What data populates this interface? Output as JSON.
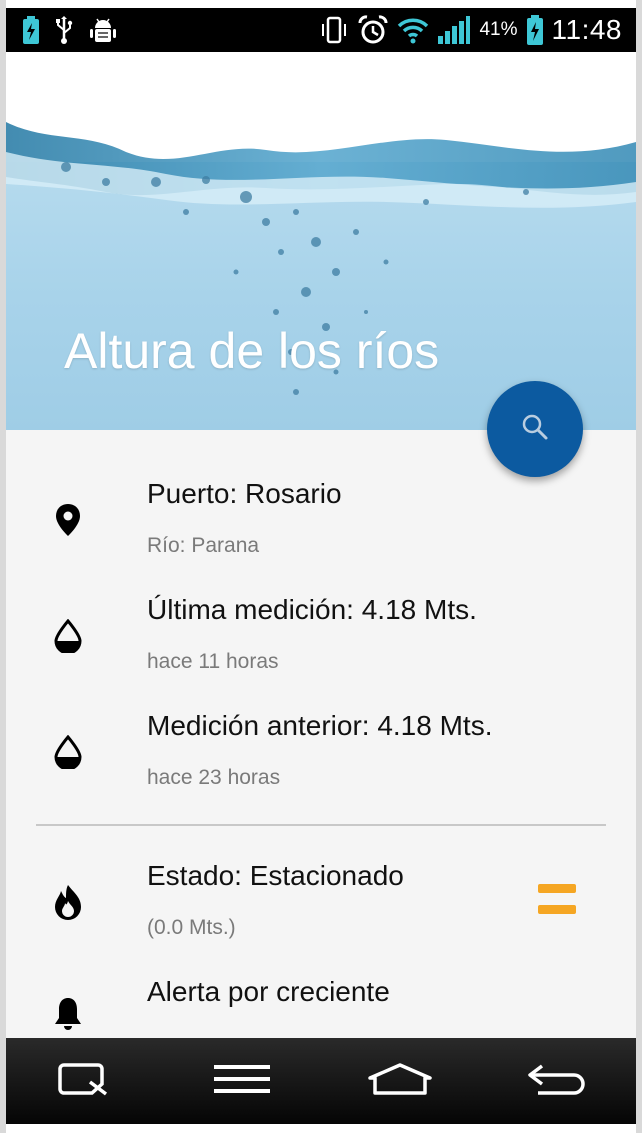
{
  "status_bar": {
    "icons_left": [
      "battery-charging-icon",
      "usb-icon",
      "android-debug-icon"
    ],
    "icons_right": [
      "vibrate-icon",
      "alarm-icon",
      "wifi-icon",
      "signal-icon"
    ],
    "battery_percent": "41%",
    "time": "11:48"
  },
  "header": {
    "title": "Altura de los ríos",
    "background": "water-splash"
  },
  "fab": {
    "icon": "search-icon",
    "color": "#0c5aa0"
  },
  "details": [
    {
      "icon": "location-pin-icon",
      "primary": "Puerto: Rosario",
      "secondary": "Río: Parana"
    },
    {
      "icon": "water-drop-icon",
      "primary": "Última medición: 4.18 Mts.",
      "secondary": "hace 11 horas"
    },
    {
      "icon": "water-drop-icon",
      "primary": "Medición anterior: 4.18 Mts.",
      "secondary": "hace 23 horas"
    }
  ],
  "status": {
    "icon": "flame-icon",
    "primary": "Estado: Estacionado",
    "secondary": "(0.0 Mts.)",
    "trend_icon": "equals-icon",
    "trend_color": "#f5a623"
  },
  "alert": {
    "icon": "bell-icon",
    "primary": "Alerta por creciente"
  },
  "nav_bar": [
    "qslide-icon",
    "menu-icon",
    "home-icon",
    "back-icon"
  ]
}
